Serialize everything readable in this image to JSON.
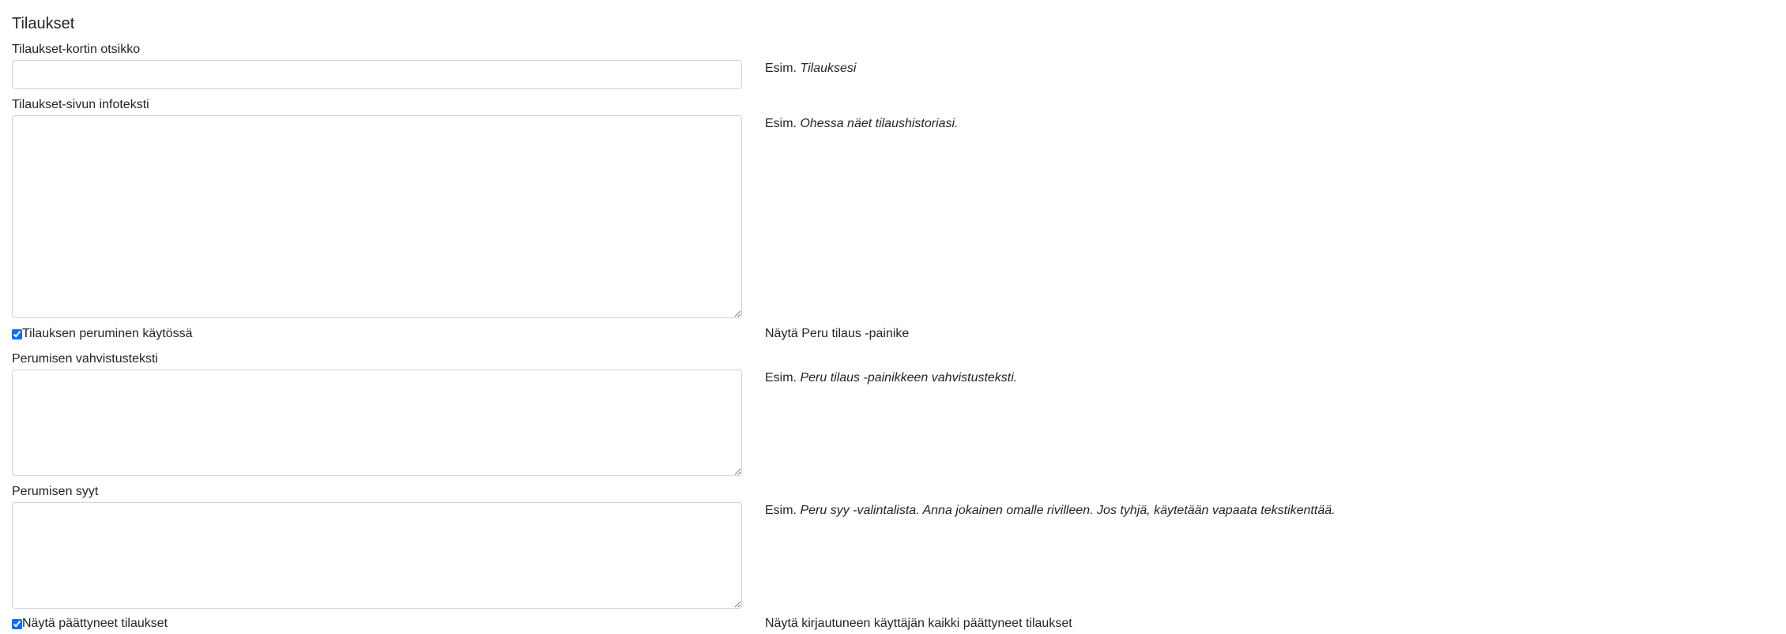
{
  "section": {
    "title": "Tilaukset"
  },
  "fields": {
    "card_title": {
      "label": "Tilaukset-kortin otsikko",
      "value": "",
      "help_prefix": "Esim.",
      "help_example": "Tilauksesi"
    },
    "info_text": {
      "label": "Tilaukset-sivun infoteksti",
      "value": "",
      "help_prefix": "Esim.",
      "help_example": "Ohessa näet tilaushistoriasi."
    },
    "cancel_enabled": {
      "label": "Tilauksen peruminen käytössä",
      "checked": true,
      "help": "Näytä Peru tilaus -painike"
    },
    "cancel_confirm": {
      "label": "Perumisen vahvistusteksti",
      "value": "",
      "help_prefix": "Esim.",
      "help_example": "Peru tilaus -painikkeen vahvistusteksti."
    },
    "cancel_reasons": {
      "label": "Perumisen syyt",
      "value": "",
      "help_prefix": "Esim.",
      "help_example": "Peru syy -valintalista. Anna jokainen omalle rivilleen. Jos tyhjä, käytetään vapaata tekstikenttää."
    },
    "show_finished": {
      "label": "Näytä päättyneet tilaukset",
      "checked": true,
      "help": "Näytä kirjautuneen käyttäjän kaikki päättyneet tilaukset"
    }
  }
}
